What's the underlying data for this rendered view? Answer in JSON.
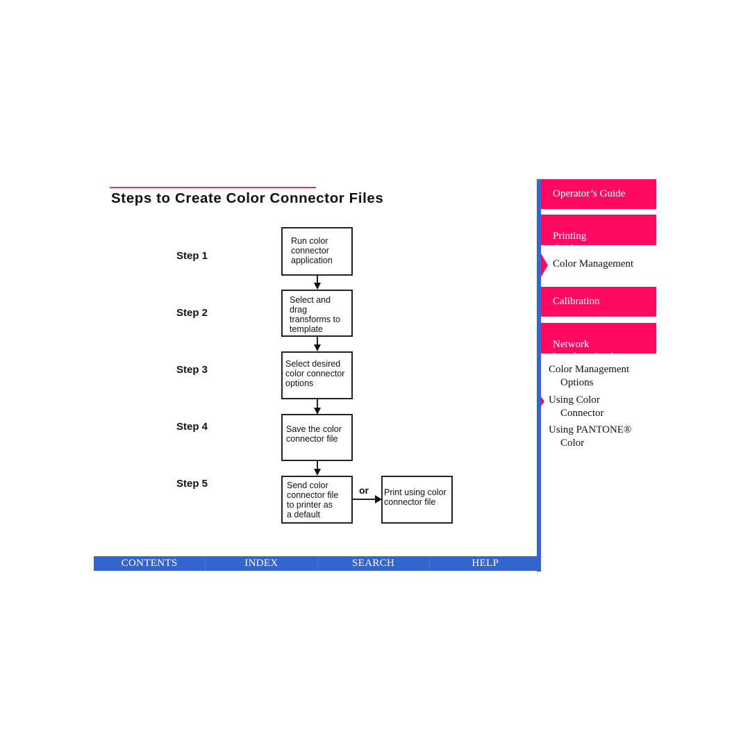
{
  "page": {
    "title": "Steps to Create Color Connector Files"
  },
  "steps": [
    {
      "label": "Step 1",
      "box": "Run color\nconnector\napplication"
    },
    {
      "label": "Step 2",
      "box": "Select and\ndrag\ntransforms to\ntemplate"
    },
    {
      "label": "Step 3",
      "box": "Select desired\ncolor connector\noptions"
    },
    {
      "label": "Step 4",
      "box": "Save the color\nconnector file"
    },
    {
      "label": "Step 5",
      "box": "Send color\nconnector file\nto printer as\na default"
    }
  ],
  "alternative": {
    "connector_label": "or",
    "box": "Print using color\nconnector file"
  },
  "sidebar": {
    "guides": [
      {
        "label": "Operator’s Guide"
      },
      {
        "label": "Printing\nGuide"
      },
      {
        "label": "Color Management",
        "current": true
      },
      {
        "label": "Calibration"
      },
      {
        "label": "Network\nInterface Guide"
      }
    ],
    "topics": [
      {
        "line1": "Color Management",
        "line2": "Options"
      },
      {
        "line1": "Using Color",
        "line2": "Connector",
        "current": true
      },
      {
        "line1": "Using PANTONE®",
        "line2": "Color"
      }
    ]
  },
  "bottom_nav": {
    "contents": "CONTENTS",
    "index": "INDEX",
    "search": "SEARCH",
    "help": "HELP"
  },
  "colors": {
    "accent_pink": "#ff0a5e",
    "nav_blue": "#3366cc",
    "rule_red": "#ff2a5a"
  }
}
